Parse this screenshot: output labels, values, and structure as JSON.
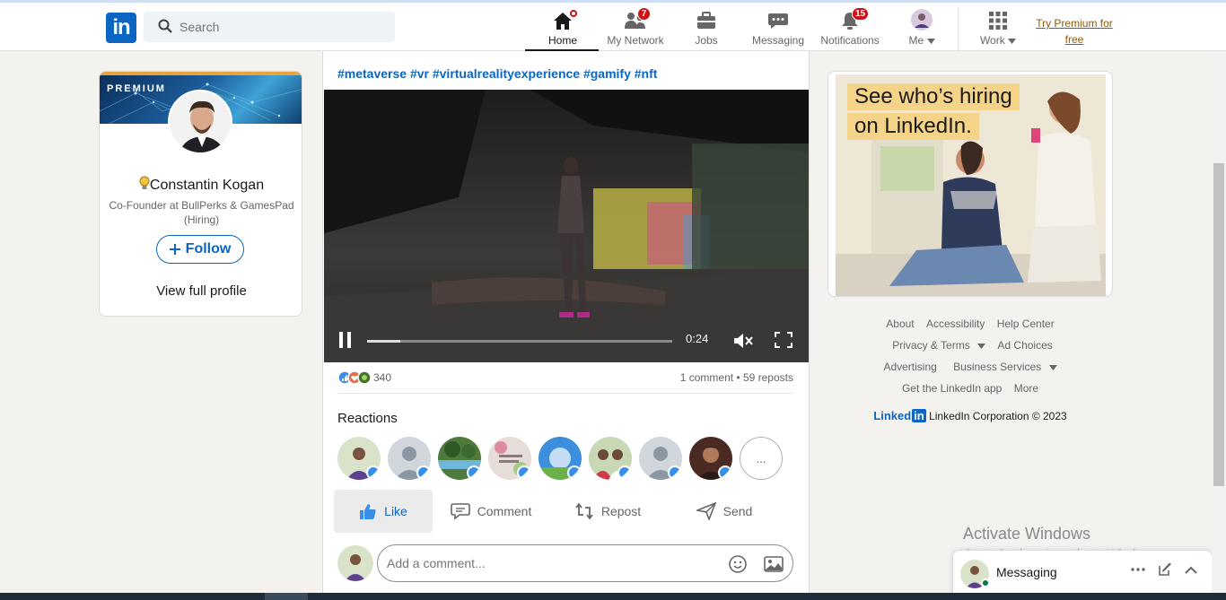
{
  "header": {
    "logo_text": "in",
    "search_placeholder": "Search",
    "nav": [
      {
        "label": "Home",
        "icon": "home-icon",
        "badge": ""
      },
      {
        "label": "My Network",
        "icon": "network-icon",
        "badge": "7"
      },
      {
        "label": "Jobs",
        "icon": "briefcase-icon",
        "badge": ""
      },
      {
        "label": "Messaging",
        "icon": "chat-icon",
        "badge": ""
      },
      {
        "label": "Notifications",
        "icon": "bell-icon",
        "badge": "15"
      },
      {
        "label": "Me",
        "icon": "avatar-icon",
        "badge": ""
      },
      {
        "label": "Work",
        "icon": "grid-icon",
        "badge": ""
      }
    ],
    "premium_link": "Try Premium for free"
  },
  "profile": {
    "premium_tag": "PREMIUM",
    "name": "Constantin Kogan",
    "headline": "Co-Founder at BullPerks & GamesPad (Hiring)",
    "follow_label": "Follow",
    "view_profile": "View full profile"
  },
  "post": {
    "hashtags": "#metaverse #vr #virtualrealityexperience #gamify #nft",
    "video": {
      "time": "0:24",
      "progress": 0.11
    },
    "reaction_count": "340",
    "comment_stats": "1 comment • 59 reposts",
    "reactions_title": "Reactions",
    "more_label": "...",
    "actions": {
      "like": "Like",
      "comment": "Comment",
      "repost": "Repost",
      "send": "Send"
    },
    "comment_placeholder": "Add a comment..."
  },
  "ad": {
    "line1": "See who’s hiring",
    "line2": "on LinkedIn."
  },
  "footer": {
    "links": [
      "About",
      "Accessibility",
      "Help Center",
      "Privacy & Terms",
      "Ad Choices",
      "Advertising",
      "Business Services",
      "Get the LinkedIn app",
      "More"
    ],
    "brand": "Linked",
    "brand_in": "in",
    "corp": "LinkedIn Corporation © 2023"
  },
  "watermark": {
    "title": "Activate Windows",
    "sub": "Go to Settings to activate Windows."
  },
  "messaging": {
    "title": "Messaging"
  },
  "colors": {
    "brand": "#0a66c2",
    "badge": "#cc1016",
    "premium": "#915907"
  }
}
